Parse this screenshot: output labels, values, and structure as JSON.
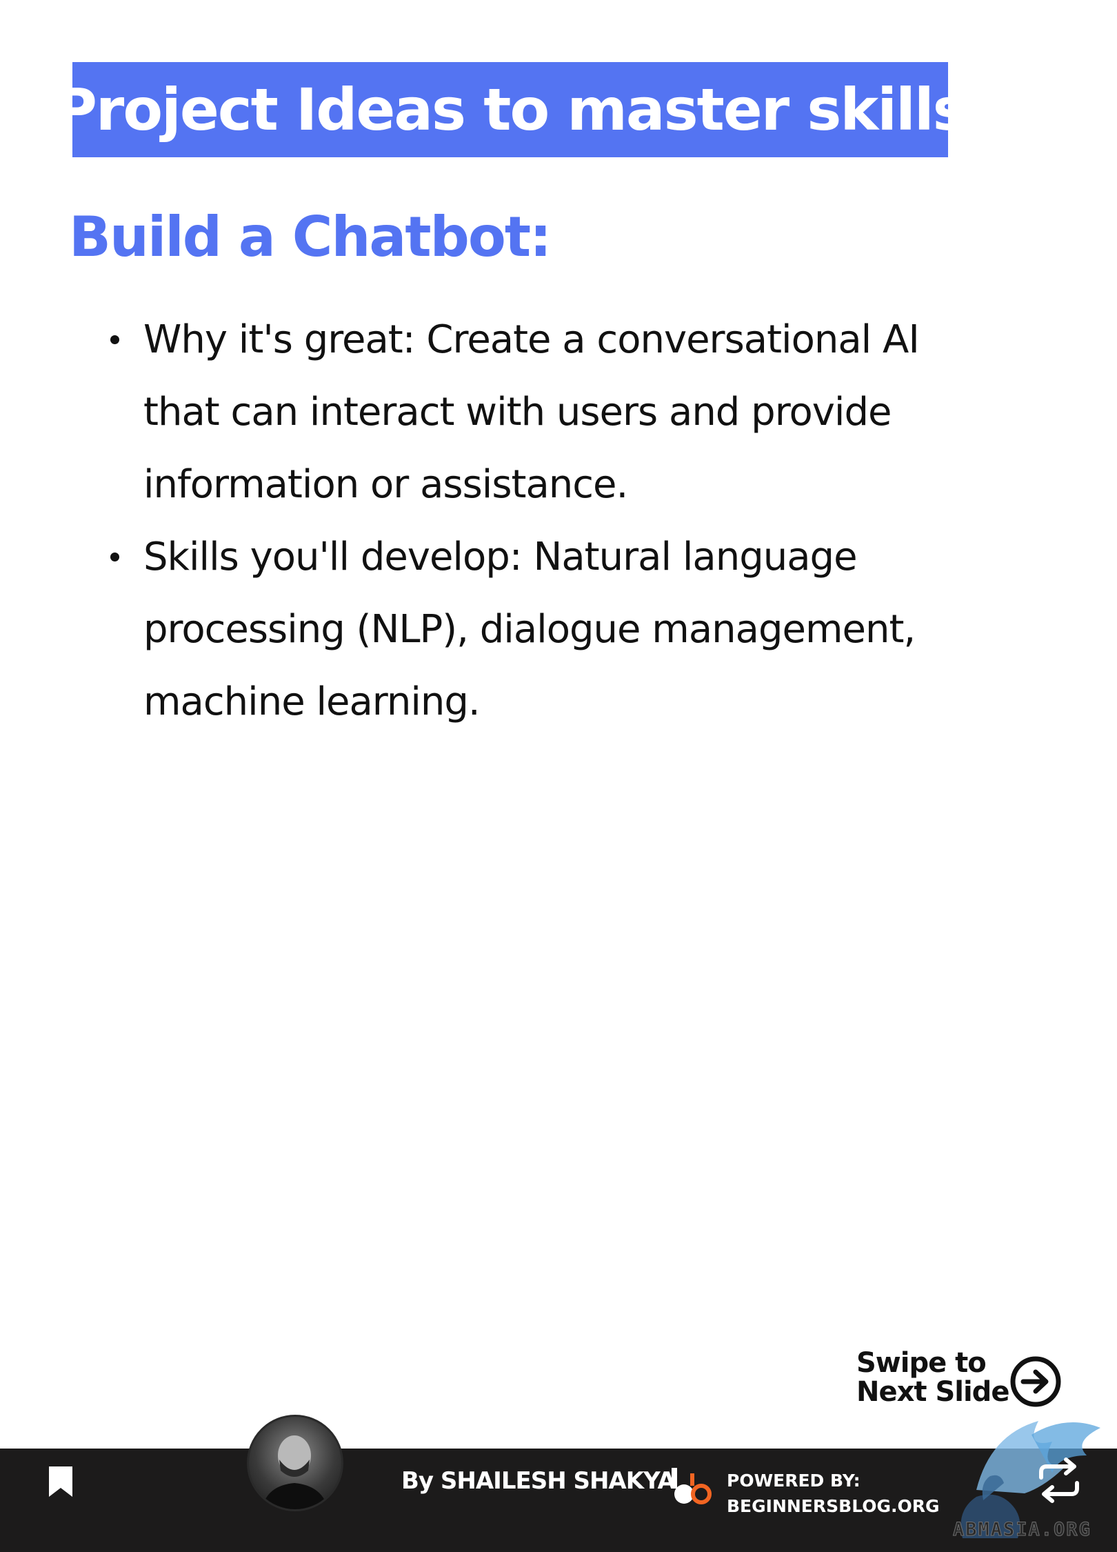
{
  "slide": {
    "title": "Project Ideas to master skills",
    "heading": "Build a Chatbot:",
    "bullets": [
      {
        "line1": "Why it's great: Create a conversational AI",
        "line2": "that can interact with users and provide",
        "line3": "information or assistance."
      },
      {
        "line1": "Skills you'll develop: Natural language",
        "line2": "processing (NLP), dialogue management,",
        "line3": "machine learning."
      }
    ],
    "swipe": {
      "line1": "Swipe to",
      "line2": "Next Slide",
      "icon": "arrow-right-circle-icon"
    }
  },
  "footer": {
    "author": "By SHAILESH SHAKYA",
    "powered_label": "POWERED BY:",
    "powered_site": "BEGINNERSBLOG.ORG",
    "icons": [
      "bookmark-icon",
      "repost-icon",
      "brand-logo"
    ]
  },
  "watermark": {
    "text": "ABMASIA.ORG"
  },
  "colors": {
    "accent": "#5474f2",
    "footer_bg": "#1c1b1b",
    "text": "#111111",
    "logo_orange": "#f26522"
  }
}
